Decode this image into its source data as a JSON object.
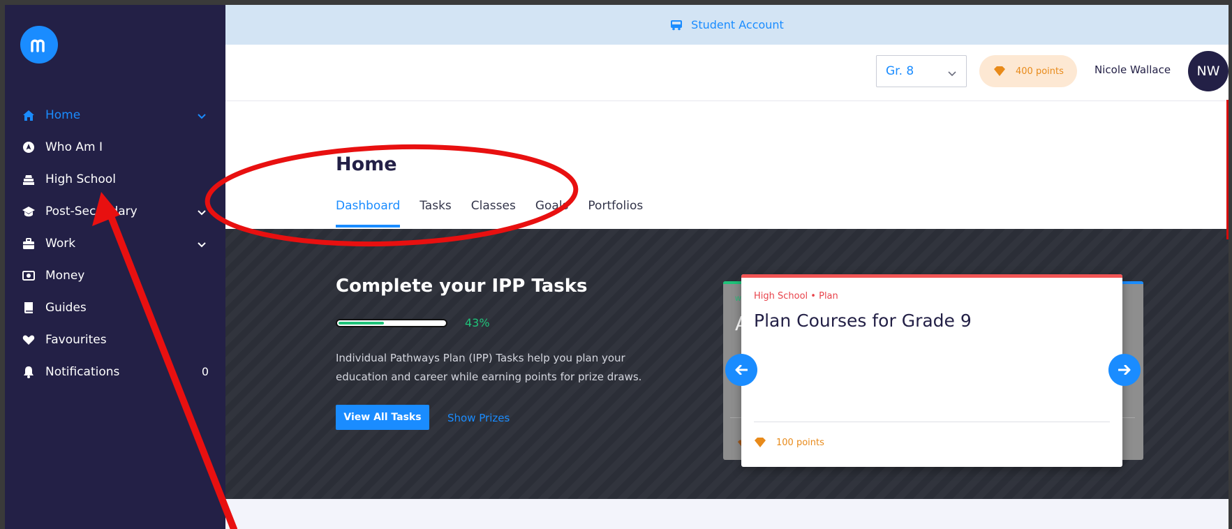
{
  "banner": {
    "label": "Student Account",
    "icon": "bus-icon"
  },
  "sidebar": {
    "logo": "m-logo",
    "items": [
      {
        "label": "Home",
        "icon": "home-icon",
        "active": true,
        "chevron": true
      },
      {
        "label": "Who Am I",
        "icon": "compass-icon"
      },
      {
        "label": "High School",
        "icon": "school-icon"
      },
      {
        "label": "Post-Secondary",
        "icon": "graduation-cap-icon",
        "chevron": true
      },
      {
        "label": "Work",
        "icon": "briefcase-icon",
        "chevron": true
      },
      {
        "label": "Money",
        "icon": "money-icon"
      },
      {
        "label": "Guides",
        "icon": "book-icon"
      },
      {
        "label": "Favourites",
        "icon": "heart-icon"
      },
      {
        "label": "Notifications",
        "icon": "bell-icon",
        "count": "0"
      }
    ]
  },
  "header": {
    "grade": "Gr. 8",
    "points": "400 points",
    "user_name": "Nicole Wallace",
    "initials": "NW"
  },
  "page": {
    "title": "Home",
    "tabs": [
      "Dashboard",
      "Tasks",
      "Classes",
      "Goals",
      "Portfolios"
    ],
    "active_tab": "Dashboard"
  },
  "ipp": {
    "title": "Complete your IPP Tasks",
    "progress_percent": 43,
    "progress_label": "43%",
    "description": "Individual Pathways Plan (IPP) Tasks help you plan your education and career while earning points for prize draws.",
    "view_all": "View All Tasks",
    "show_prizes": "Show Prizes"
  },
  "carousel": {
    "back_card": {
      "category_fragment": "W",
      "title_fragment": "A"
    },
    "card": {
      "category": "High School • Plan",
      "title": "Plan Courses for Grade 9",
      "points": "100 points"
    }
  },
  "colors": {
    "accent": "#1a8cff",
    "sidebar": "#232046",
    "success": "#1fc37a",
    "points": "#e88a1a",
    "annotation": "#e81010"
  }
}
